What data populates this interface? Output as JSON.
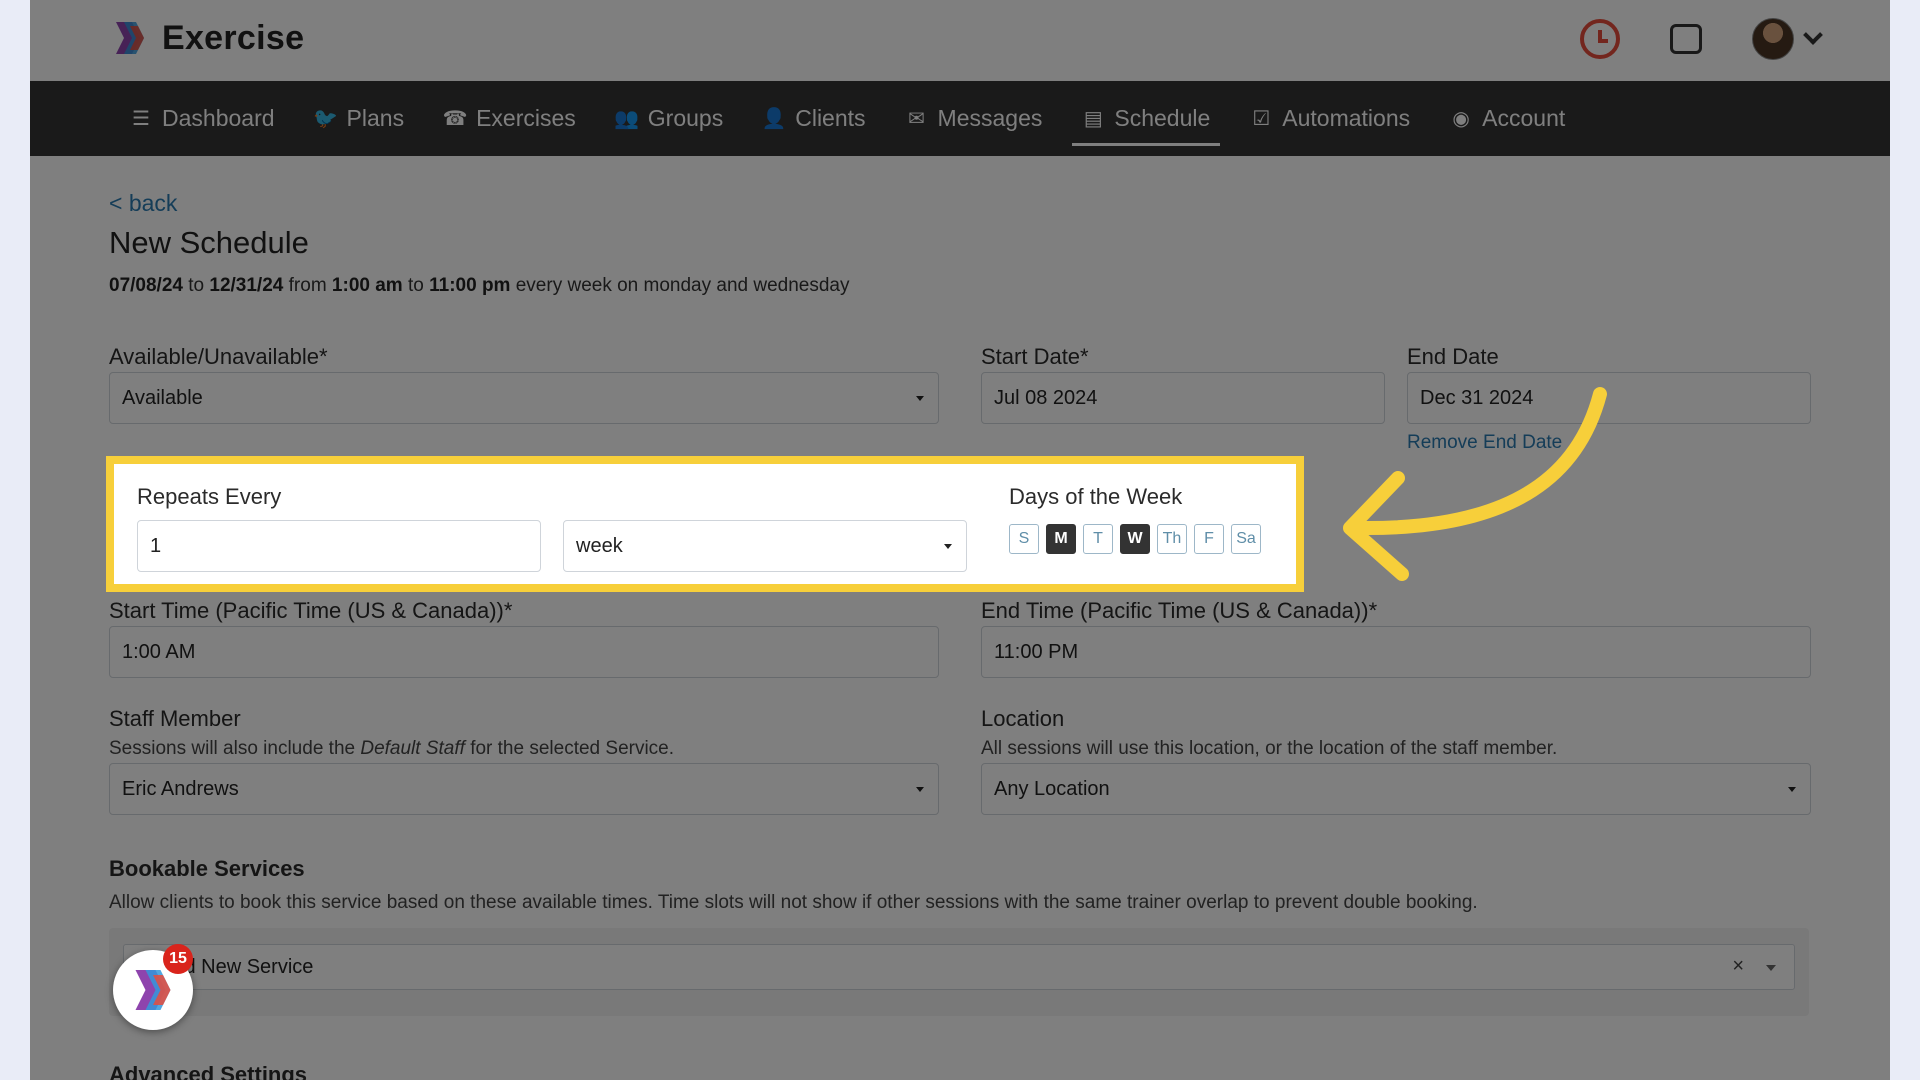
{
  "app": {
    "name": "Exercise"
  },
  "nav": {
    "items": [
      {
        "label": "Dashboard",
        "icon": "list-icon"
      },
      {
        "label": "Plans",
        "icon": "twitter-icon"
      },
      {
        "label": "Exercises",
        "icon": "phone-square-icon"
      },
      {
        "label": "Groups",
        "icon": "users-icon"
      },
      {
        "label": "Clients",
        "icon": "user-icon"
      },
      {
        "label": "Messages",
        "icon": "envelope-icon"
      },
      {
        "label": "Schedule",
        "icon": "book-icon",
        "active": true
      },
      {
        "label": "Automations",
        "icon": "check-square-icon"
      },
      {
        "label": "Account",
        "icon": "user-circle-icon"
      }
    ]
  },
  "page": {
    "back": "< back",
    "title": "New Schedule",
    "summary": {
      "start": "07/08/24",
      "to1": "to",
      "end": "12/31/24",
      "from": "from",
      "start_time": "1:00 am",
      "to2": "to",
      "end_time": "11:00 pm",
      "rest": "every week on monday and wednesday"
    }
  },
  "form": {
    "availability": {
      "label": "Available/Unavailable*",
      "value": "Available"
    },
    "start_date": {
      "label": "Start Date*",
      "value": "Jul 08 2024"
    },
    "end_date": {
      "label": "End Date",
      "value": "Dec 31 2024",
      "remove": "Remove End Date"
    },
    "repeats": {
      "label": "Repeats Every",
      "value": "1",
      "unit": "week"
    },
    "days": {
      "label": "Days of the Week",
      "items": [
        {
          "label": "S",
          "selected": false
        },
        {
          "label": "M",
          "selected": true
        },
        {
          "label": "T",
          "selected": false
        },
        {
          "label": "W",
          "selected": true
        },
        {
          "label": "Th",
          "selected": false
        },
        {
          "label": "F",
          "selected": false
        },
        {
          "label": "Sa",
          "selected": false
        }
      ]
    },
    "start_time": {
      "label": "Start Time (Pacific Time (US & Canada))*",
      "value": "1:00 AM"
    },
    "end_time": {
      "label": "End Time (Pacific Time (US & Canada))*",
      "value": "11:00 PM"
    },
    "staff": {
      "label": "Staff Member",
      "help_pre": "Sessions will also include the ",
      "help_em": "Default Staff",
      "help_post": " for the selected Service.",
      "value": "Eric Andrews"
    },
    "location": {
      "label": "Location",
      "help": "All sessions will use this location, or the location of the staff member.",
      "value": "Any Location"
    },
    "services": {
      "label": "Bookable Services",
      "help": "Allow clients to book this service based on these available times. Time slots will not show if other sessions with the same trainer overlap to prevent double booking.",
      "placeholder": "Add New Service",
      "clear": "×"
    },
    "advanced": {
      "label": "Advanced Settings"
    }
  },
  "fab": {
    "badge": "15"
  },
  "colors": {
    "highlight": "#f7cf3a",
    "link": "#2a7ab0",
    "nav_bg": "#343434",
    "badge": "#d9241c"
  }
}
